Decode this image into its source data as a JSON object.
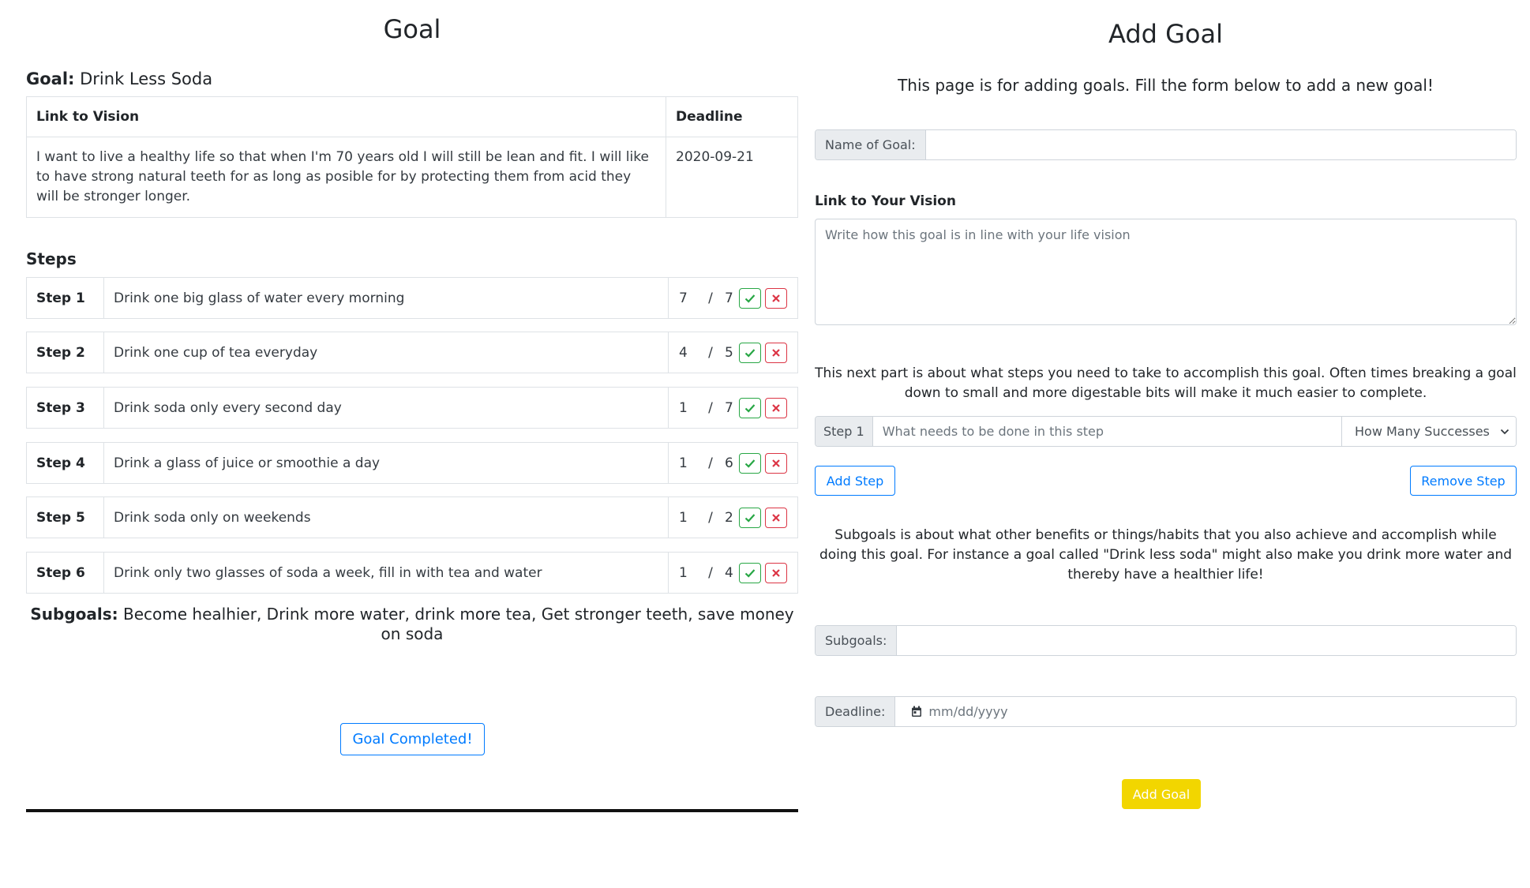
{
  "goal_view": {
    "title": "Goal",
    "goal_label": "Goal:",
    "goal_name": "Drink Less Soda",
    "table": {
      "col_vision": "Link to Vision",
      "col_deadline": "Deadline",
      "vision_text": "I want to live a healthy life so that when I'm 70 years old I will still be lean and fit. I will like to have strong natural teeth for as long as posible for by protecting them from acid they will be stronger longer.",
      "deadline": "2020-09-21"
    },
    "steps_heading": "Steps",
    "steps": [
      {
        "label": "Step 1",
        "text": "Drink one big glass of water every morning",
        "done": "7",
        "total": "7"
      },
      {
        "label": "Step 2",
        "text": "Drink one cup of tea everyday",
        "done": "4",
        "total": "5"
      },
      {
        "label": "Step 3",
        "text": "Drink soda only every second day",
        "done": "1",
        "total": "7"
      },
      {
        "label": "Step 4",
        "text": "Drink a glass of juice or smoothie a day",
        "done": "1",
        "total": "6"
      },
      {
        "label": "Step 5",
        "text": "Drink soda only on weekends",
        "done": "1",
        "total": "2"
      },
      {
        "label": "Step 6",
        "text": "Drink only two glasses of soda a week, fill in with tea and water",
        "done": "1",
        "total": "4"
      }
    ],
    "slash": "/",
    "subgoals_label": "Subgoals:",
    "subgoals_text": "Become healhier, Drink more water, drink more tea, Get stronger teeth, save money on soda",
    "completed_button": "Goal Completed!"
  },
  "add_goal": {
    "title": "Add Goal",
    "intro": "This page is for adding goals. Fill the form below to add a new goal!",
    "name_prefix": "Name of Goal:",
    "name_value": "",
    "vision_label": "Link to Your Vision",
    "vision_placeholder": "Write how this goal is in line with your life vision",
    "steps_intro": "This next part is about what steps you need to take to accomplish this goal. Often times breaking a goal down to small and more digestable bits will make it much easier to complete.",
    "step_prefix": "Step 1",
    "step_placeholder": "What needs to be done in this step",
    "step_select": "How Many Successes",
    "add_step": "Add Step",
    "remove_step": "Remove Step",
    "subgoals_intro": "Subgoals is about what other benefits or things/habits that you also achieve and accomplish while doing this goal. For instance a goal called \"Drink less soda\" might also make you drink more water and thereby have a healthier life!",
    "subgoals_prefix": "Subgoals:",
    "deadline_prefix": "Deadline:",
    "deadline_placeholder": "mm/dd/yyyy",
    "submit": "Add Goal"
  },
  "colors": {
    "primary": "#007bff",
    "success": "#28a745",
    "danger": "#dc3545",
    "submit": "#f2d600"
  },
  "icons": [
    "check-icon",
    "x-icon",
    "calendar-icon",
    "chevron-down-icon"
  ]
}
